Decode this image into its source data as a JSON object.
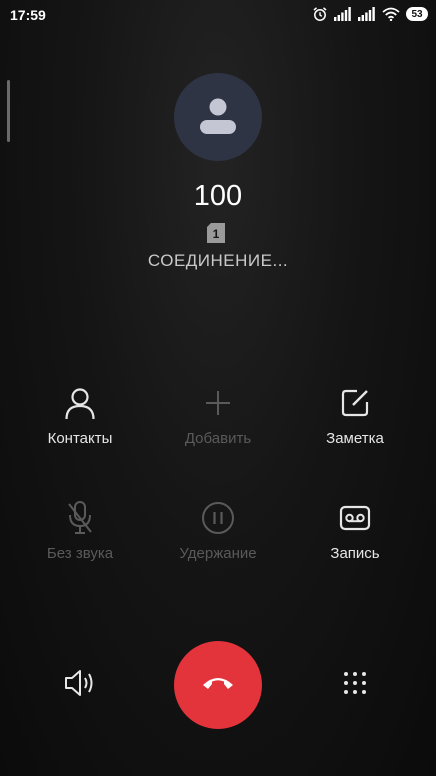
{
  "status_bar": {
    "time": "17:59",
    "battery": "53",
    "icons": [
      "alarm-icon",
      "signal-icon",
      "signal-icon",
      "wifi-icon",
      "battery-icon"
    ]
  },
  "caller": {
    "avatar_icon": "person-icon",
    "number": "100",
    "sim_label": "1",
    "status": "СОЕДИНЕНИЕ..."
  },
  "actions": {
    "contacts": {
      "label": "Контакты",
      "icon": "person-outline-icon",
      "enabled": true
    },
    "add": {
      "label": "Добавить",
      "icon": "plus-icon",
      "enabled": false
    },
    "note": {
      "label": "Заметка",
      "icon": "edit-note-icon",
      "enabled": true
    },
    "mute": {
      "label": "Без звука",
      "icon": "mic-off-icon",
      "enabled": false
    },
    "hold": {
      "label": "Удержание",
      "icon": "pause-icon",
      "enabled": false
    },
    "record": {
      "label": "Запись",
      "icon": "voicemail-icon",
      "enabled": true
    }
  },
  "bottom": {
    "speaker_icon": "speaker-icon",
    "end_call_icon": "hang-up-icon",
    "dialpad_icon": "dialpad-icon"
  },
  "colors": {
    "end_call": "#e3343c",
    "avatar_bg": "#2f3444",
    "disabled": "#5a5a5a",
    "enabled": "#e6e6e6"
  }
}
